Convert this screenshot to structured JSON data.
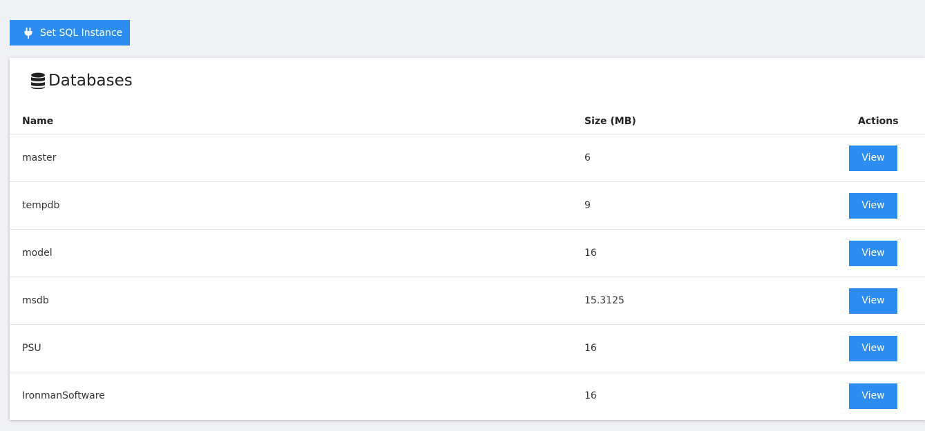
{
  "toolbar": {
    "set_instance_label": "Set SQL Instance",
    "accent_color": "#2d8cf0"
  },
  "card": {
    "title": "Databases",
    "icon": "database-icon"
  },
  "table": {
    "headers": {
      "name": "Name",
      "size": "Size (MB)",
      "actions": "Actions"
    },
    "rows": [
      {
        "name": "master",
        "size": "6",
        "action": "View"
      },
      {
        "name": "tempdb",
        "size": "9",
        "action": "View"
      },
      {
        "name": "model",
        "size": "16",
        "action": "View"
      },
      {
        "name": "msdb",
        "size": "15.3125",
        "action": "View"
      },
      {
        "name": "PSU",
        "size": "16",
        "action": "View"
      },
      {
        "name": "IronmanSoftware",
        "size": "16",
        "action": "View"
      }
    ]
  }
}
